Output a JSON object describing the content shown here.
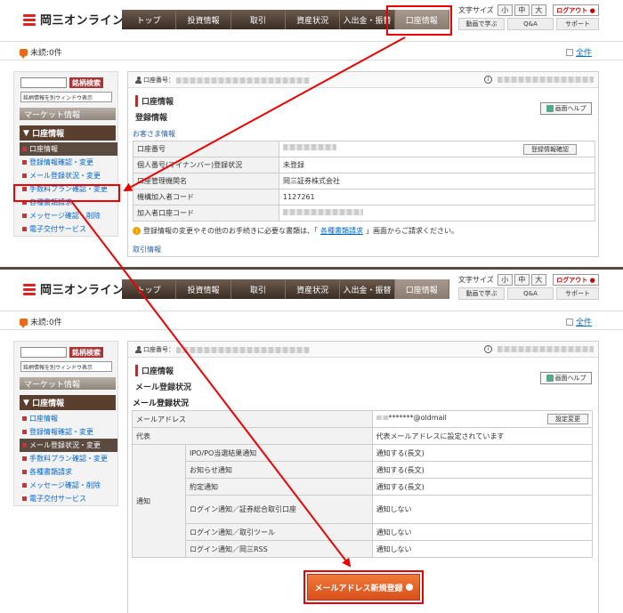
{
  "brand": {
    "name": "岡三オンライン"
  },
  "nav": [
    "トップ",
    "投資情報",
    "取引",
    "資産状況",
    "入出金・振替",
    "口座情報"
  ],
  "font_size": {
    "label": "文字サイズ",
    "small": "小",
    "medium": "中",
    "large": "大"
  },
  "logout": "ログアウト",
  "subnav": {
    "learn": "動画で学ぶ",
    "qa": "Q&A",
    "support": "サポート"
  },
  "unread": "未読:0件",
  "allread": "全件",
  "sidebar": {
    "search_btn": "銘柄検索",
    "newwin": "銘柄情報を別ウィンドウ表示",
    "market": "マーケット情報",
    "account_header": "口座情報",
    "items": [
      "口座情報",
      "登録情報確認・変更",
      "メール登録状況・変更",
      "手数料プラン確認・変更",
      "各種書類請求",
      "メッセージ確認・削除",
      "電子交付サービス"
    ]
  },
  "top": {
    "account_label": "口座番号：",
    "title1": "口座情報",
    "title2": "登録情報",
    "help": "画面ヘルプ",
    "section": "お客さま情報",
    "rows": [
      {
        "k": "口座番号",
        "v": ""
      },
      {
        "k": "個人番号(マイナンバー)登録状況",
        "v": "未登録"
      },
      {
        "k": "口座管理機関名",
        "v": "岡三証券株式会社"
      },
      {
        "k": "機構加入者コード",
        "v": "1127261"
      },
      {
        "k": "加入者口座コード",
        "v": ""
      }
    ],
    "confirm_btn": "登録情報確認",
    "notice_pre": "登録情報の変更やその他のお手続きに必要な書類は、「",
    "notice_link": "各種書類請求",
    "notice_post": "」画面からご請求ください。",
    "trade_info": "取引情報"
  },
  "bottom": {
    "account_label": "口座番号：",
    "title1": "口座情報",
    "title2": "メール登録状況",
    "help": "画面ヘルプ",
    "section": "メール登録状況",
    "email_label": "メールアドレス",
    "email_value": "*******@oldmail",
    "settings_btn": "設定変更",
    "rep_label": "代表",
    "rep_value": "代表メールアドレスに設定されています",
    "notify_label": "通知",
    "notifications": [
      {
        "k": "IPO/PO当選結果通知",
        "v": "通知する(長文)"
      },
      {
        "k": "お知らせ通知",
        "v": "通知する(長文)"
      },
      {
        "k": "約定通知",
        "v": "通知する(長文)"
      },
      {
        "k": "ログイン通知／証券総合取引口座",
        "v": "通知しない"
      },
      {
        "k": "ログイン通知／取引ツール",
        "v": "通知しない"
      },
      {
        "k": "ログイン通知／岡三RSS",
        "v": "通知しない"
      }
    ],
    "register_btn": "メールアドレス新規登録"
  },
  "colors": {
    "accent": "#e00000",
    "nav": "#4a3a30",
    "button": "#e8642a"
  }
}
